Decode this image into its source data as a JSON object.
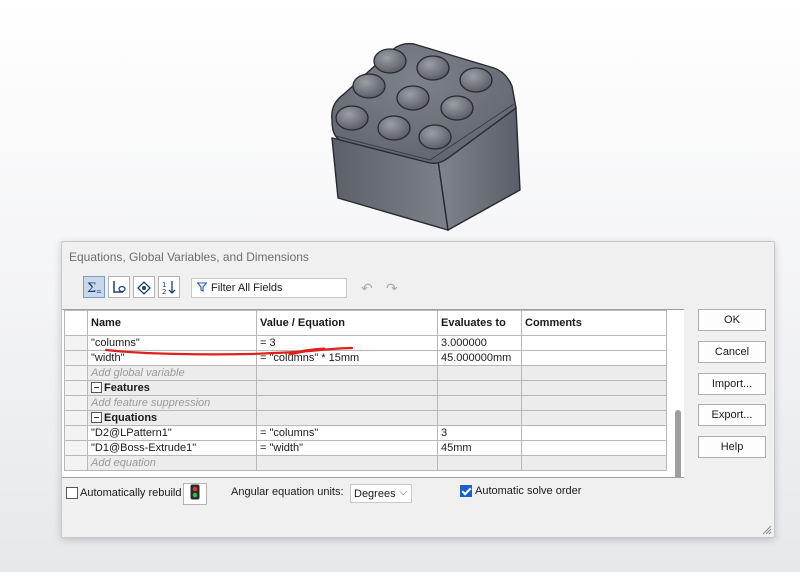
{
  "dialog": {
    "title": "Equations, Global Variables, and Dimensions",
    "filter_placeholder": "Filter All Fields"
  },
  "toolbar": {
    "buttons": [
      {
        "icon": "equation-view-icon",
        "active": true
      },
      {
        "icon": "sketch-equation-view-icon",
        "active": false
      },
      {
        "icon": "dimension-view-icon",
        "active": false
      },
      {
        "icon": "ordered-view-icon",
        "active": false
      }
    ]
  },
  "table": {
    "headers": [
      "Name",
      "Value / Equation",
      "Evaluates to",
      "Comments"
    ],
    "rows": {
      "columns": {
        "name": "\"columns\"",
        "value": "= 3",
        "evaluates": "3.000000",
        "comments": ""
      },
      "width": {
        "name": "\"width\"",
        "value": "= \"columns\" * 15mm",
        "evaluates": "45.000000mm",
        "comments": ""
      },
      "add_global": "Add global variable",
      "features_label": "Features",
      "add_feature": "Add feature suppression",
      "equations_label": "Equations",
      "eq1": {
        "name": "\"D2@LPattern1\"",
        "value": "= \"columns\"",
        "evaluates": "3",
        "comments": ""
      },
      "eq2": {
        "name": "\"D1@Boss-Extrude1\"",
        "value": "= \"width\"",
        "evaluates": "45mm",
        "comments": ""
      },
      "add_equation": "Add equation"
    }
  },
  "buttons": {
    "ok": "OK",
    "cancel": "Cancel",
    "import": "Import...",
    "export": "Export...",
    "help": "Help"
  },
  "footer": {
    "auto_rebuild_label": "Automatically rebuild",
    "auto_rebuild_checked": false,
    "units_label": "Angular equation units:",
    "units_value": "Degrees",
    "auto_solve_label": "Automatic solve order",
    "auto_solve_checked": true
  },
  "colors": {
    "annotation_red": "#e0201c",
    "model_body": "#6f737c",
    "accent_blue": "#1a62c8"
  }
}
